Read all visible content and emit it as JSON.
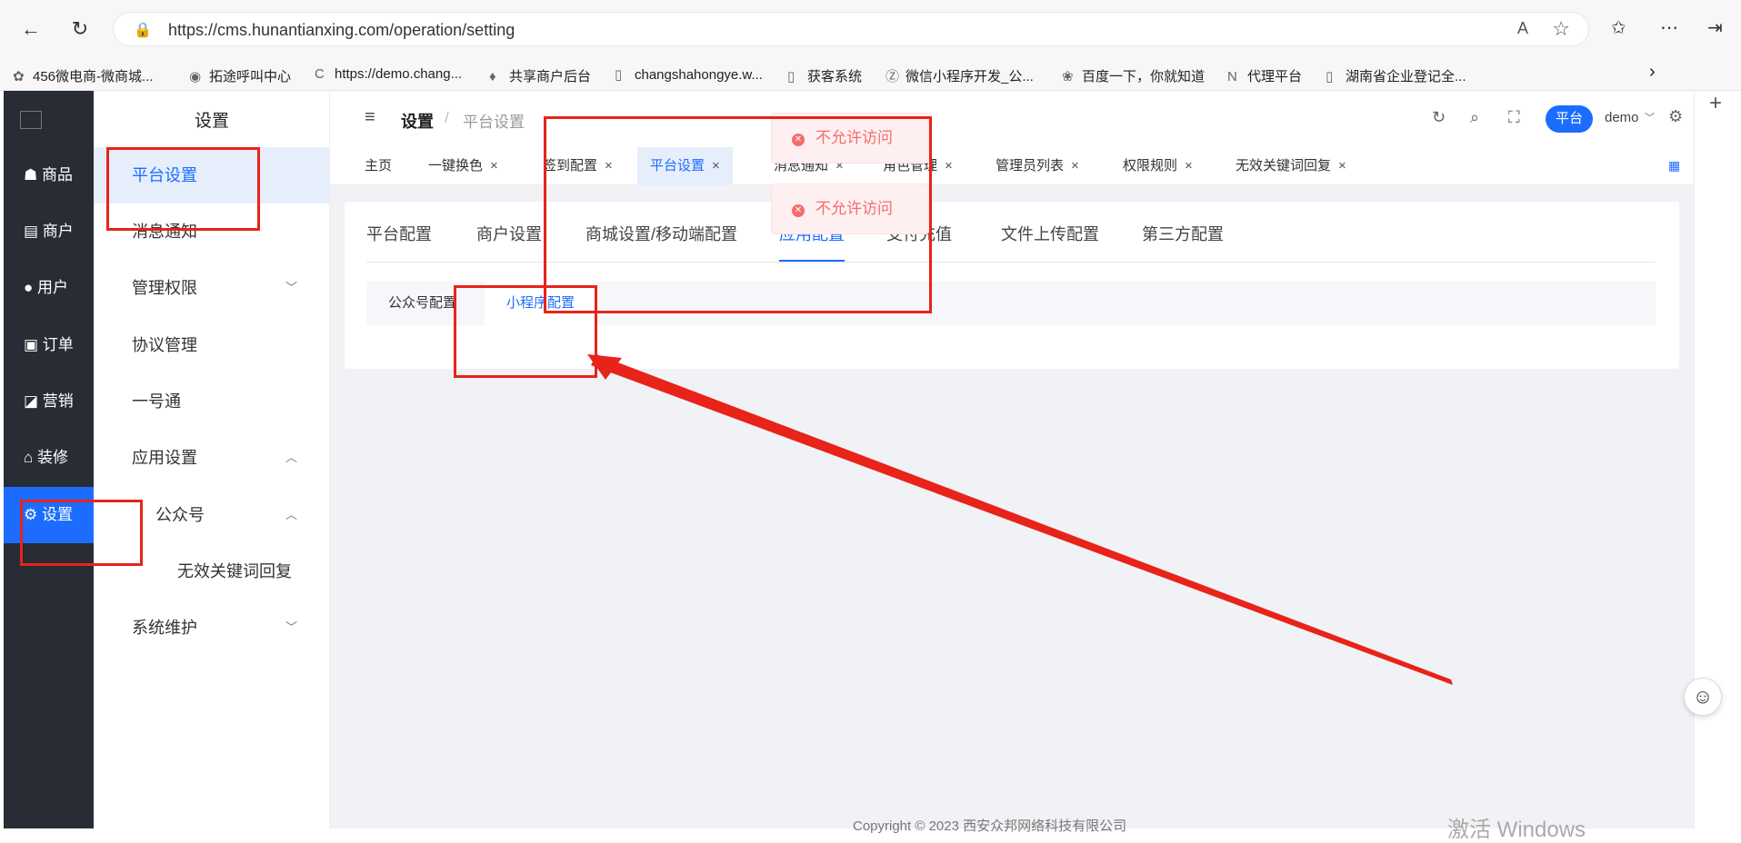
{
  "browser": {
    "url": "https://cms.hunantianxing.com/operation/setting",
    "read_aloud": "Aͅ",
    "bookmarks": [
      "456微电商-微商城...",
      "拓途呼叫中心",
      "https://demo.chang...",
      "共享商户后台",
      "changshahongye.w...",
      "获客系统",
      "微信小程序开发_公...",
      "百度一下，你就知道",
      "代理平台",
      "湖南省企业登记全..."
    ]
  },
  "sidebar_dark": {
    "items": [
      {
        "icon": "bag",
        "label": "商品"
      },
      {
        "icon": "store",
        "label": "商户"
      },
      {
        "icon": "person",
        "label": "用户"
      },
      {
        "icon": "clipboard",
        "label": "订单"
      },
      {
        "icon": "chart",
        "label": "营销"
      },
      {
        "icon": "home",
        "label": "装修"
      },
      {
        "icon": "gear",
        "label": "设置"
      }
    ]
  },
  "sidebar_light": {
    "title": "设置",
    "items": [
      {
        "label": "平台设置"
      },
      {
        "label": "消息通知"
      },
      {
        "label": "管理权限"
      },
      {
        "label": "协议管理"
      },
      {
        "label": "一号通"
      },
      {
        "label": "应用设置"
      },
      {
        "label": "公众号"
      },
      {
        "label": "无效关键词回复"
      },
      {
        "label": "系统维护"
      }
    ]
  },
  "header": {
    "breadcrumb_root": "设置",
    "breadcrumb_sep": "/",
    "breadcrumb_current": "平台设置",
    "role_badge": "平台",
    "user": "demo"
  },
  "tabs": [
    {
      "label": "主页"
    },
    {
      "label": "一键换色"
    },
    {
      "label": "签到配置"
    },
    {
      "label": "平台设置"
    },
    {
      "label": "消息通知"
    },
    {
      "label": "角色管理"
    },
    {
      "label": "管理员列表"
    },
    {
      "label": "权限规则"
    },
    {
      "label": "无效关键词回复"
    }
  ],
  "content": {
    "tabs": [
      "平台配置",
      "商户设置",
      "商城设置/移动端配置",
      "应用配置",
      "支付充值",
      "文件上传配置",
      "第三方配置"
    ],
    "subtabs": [
      "公众号配置",
      "小程序配置"
    ]
  },
  "toasts": [
    "不允许访问",
    "不允许访问"
  ],
  "footer": "Copyright © 2023 西安众邦网络科技有限公司",
  "watermark": "激活 Windows",
  "colors": {
    "accent": "#1c6dff",
    "sidebar": "#282c34",
    "annotation": "#e8231a",
    "error": "#f56c6c"
  }
}
